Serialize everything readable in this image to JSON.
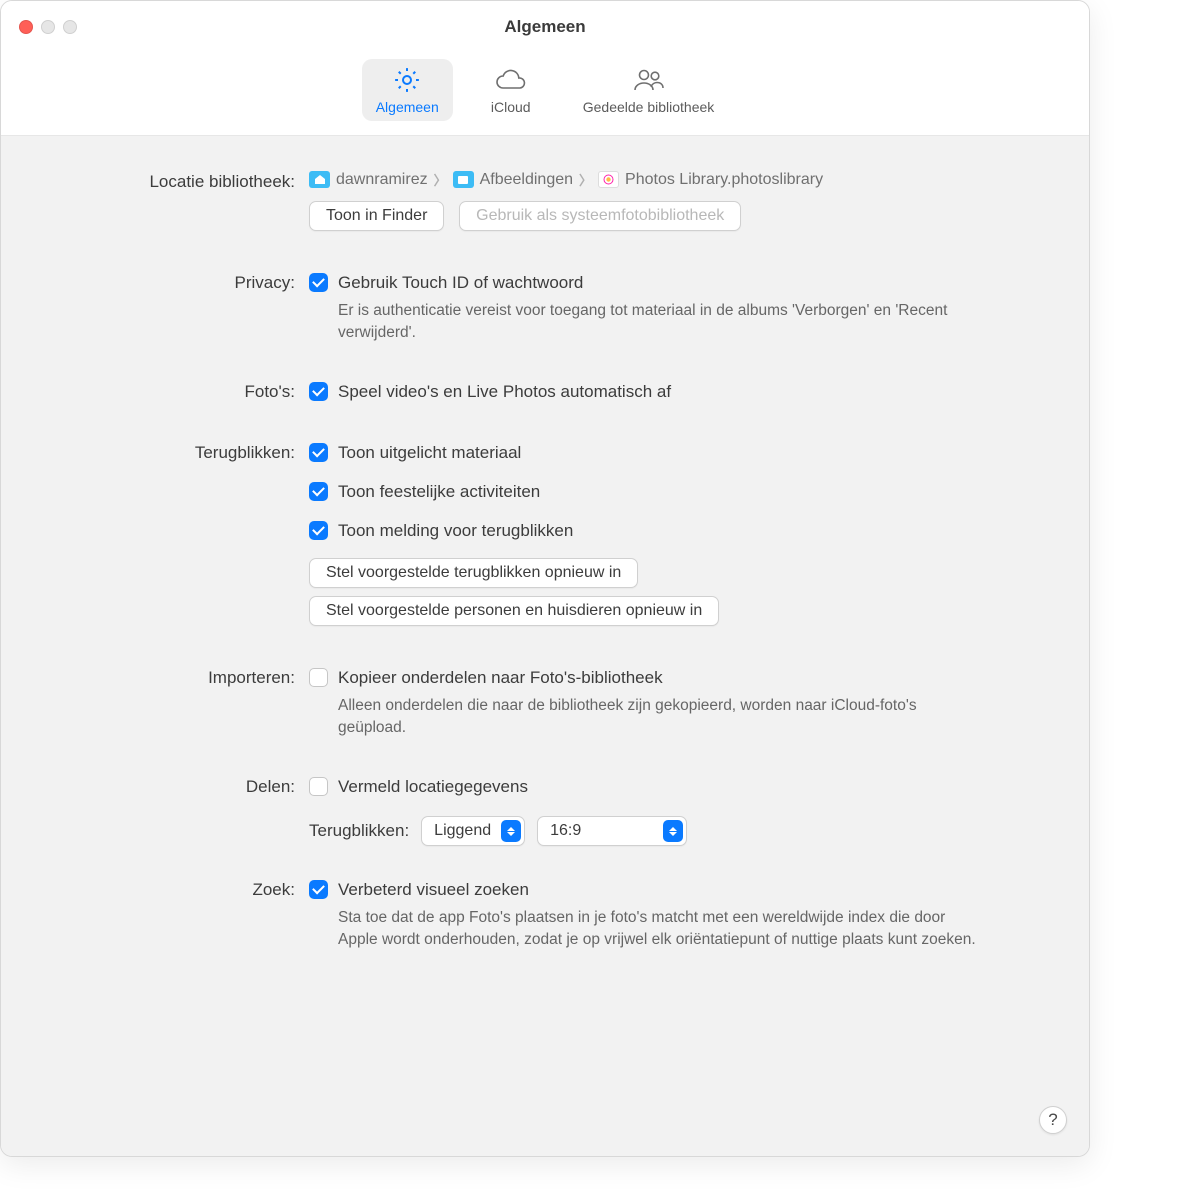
{
  "window": {
    "title": "Algemeen"
  },
  "tabs": [
    {
      "label": "Algemeen"
    },
    {
      "label": "iCloud"
    },
    {
      "label": "Gedeelde bibliotheek"
    }
  ],
  "library": {
    "label": "Locatie bibliotheek:",
    "crumbs": [
      "dawnramirez",
      "Afbeeldingen",
      "Photos Library.photoslibrary"
    ],
    "showInFinder": "Toon in Finder",
    "useAsSystemLib": "Gebruik als systeemfotobibliotheek"
  },
  "privacy": {
    "label": "Privacy:",
    "checkbox": "Gebruik Touch ID of wachtwoord",
    "subtext": "Er is authenticatie vereist voor toegang tot materiaal in de albums 'Verborgen' en 'Recent verwijderd'."
  },
  "photos": {
    "label": "Foto's:",
    "checkbox": "Speel video's en Live Photos automatisch af"
  },
  "memories": {
    "label": "Terugblikken:",
    "c1": "Toon uitgelicht materiaal",
    "c2": "Toon feestelijke activiteiten",
    "c3": "Toon melding voor terugblikken",
    "btn1": "Stel voorgestelde terugblikken opnieuw in",
    "btn2": "Stel voorgestelde personen en huisdieren opnieuw in"
  },
  "import": {
    "label": "Importeren:",
    "checkbox": "Kopieer onderdelen naar Foto's-bibliotheek",
    "subtext": "Alleen onderdelen die naar de bibliotheek zijn gekopieerd, worden naar iCloud-foto's geüpload."
  },
  "sharing": {
    "label": "Delen:",
    "checkbox": "Vermeld locatiegegevens",
    "memoriesLabel": "Terugblikken:",
    "select1": "Liggend",
    "select2": "16:9"
  },
  "search": {
    "label": "Zoek:",
    "checkbox": "Verbeterd visueel zoeken",
    "subtext": "Sta toe dat de app Foto's plaatsen in je foto's matcht met een wereldwijde index die door Apple wordt onderhouden, zodat je op vrijwel elk oriëntatiepunt of nuttige plaats kunt zoeken."
  },
  "help": "?"
}
